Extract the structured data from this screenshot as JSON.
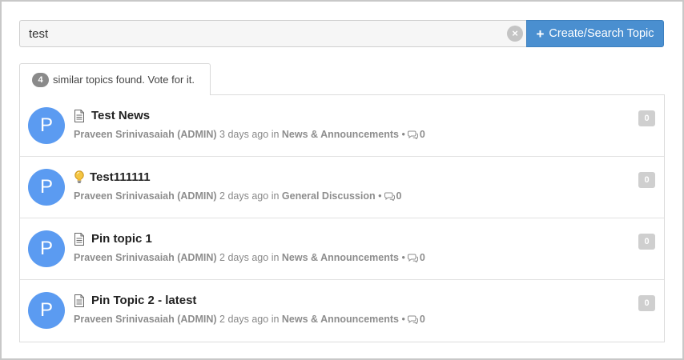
{
  "search": {
    "value": "test",
    "clear_glyph": "×",
    "button_label": "Create/Search Topic",
    "button_icon": "plus-icon",
    "button_color": "#4a8fd0"
  },
  "tab": {
    "count": "4",
    "label": "similar topics found. Vote for it."
  },
  "topics": [
    {
      "avatar_letter": "P",
      "icon": "document-icon",
      "title": "Test News",
      "author": "Praveen Srinivasaiah (ADMIN)",
      "time": "3 days ago",
      "in_word": "in",
      "category": "News & Announcements",
      "separator": "•",
      "comments": "0",
      "votes": "0"
    },
    {
      "avatar_letter": "P",
      "icon": "lightbulb-icon",
      "title": "Test111111",
      "author": "Praveen Srinivasaiah (ADMIN)",
      "time": "2 days ago",
      "in_word": "in",
      "category": "General Discussion",
      "separator": "•",
      "comments": "0",
      "votes": "0"
    },
    {
      "avatar_letter": "P",
      "icon": "document-icon",
      "title": "Pin topic 1",
      "author": "Praveen Srinivasaiah (ADMIN)",
      "time": "2 days ago",
      "in_word": "in",
      "category": "News & Announcements",
      "separator": "•",
      "comments": "0",
      "votes": "0"
    },
    {
      "avatar_letter": "P",
      "icon": "document-icon",
      "title": "Pin Topic 2 - latest",
      "author": "Praveen Srinivasaiah (ADMIN)",
      "time": "2 days ago",
      "in_word": "in",
      "category": "News & Announcements",
      "separator": "•",
      "comments": "0",
      "votes": "0"
    }
  ],
  "colors": {
    "avatar": "#5b9bf1",
    "badge": "#cfcfcf"
  }
}
